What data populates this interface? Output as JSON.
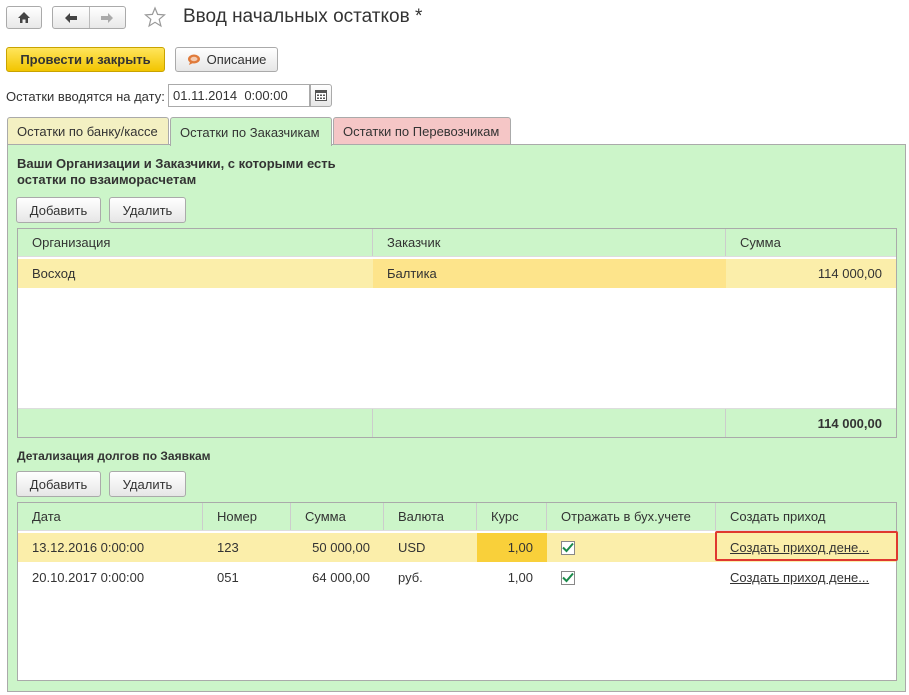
{
  "window": {
    "title": "Ввод начальных остатков *"
  },
  "toolbar": {
    "post_close_label": "Провести и закрыть",
    "description_label": "Описание"
  },
  "date_field": {
    "label": "Остатки вводятся на дату:",
    "value": "01.11.2014  0:00:00"
  },
  "tabs": [
    {
      "label": "Остатки по банку/кассе",
      "color": "#f3f0c2"
    },
    {
      "label": "Остатки по Заказчикам",
      "color": "#ccf5c9",
      "active": true
    },
    {
      "label": "Остатки по Перевозчикам",
      "color": "#f5c6c6"
    }
  ],
  "orgs_section": {
    "title_line1": "Ваши Организации и Заказчики, с которыми есть",
    "title_line2": "остатки по взаиморасчетам",
    "add_label": "Добавить",
    "delete_label": "Удалить",
    "columns": [
      "Организация",
      "Заказчик",
      "Сумма"
    ],
    "rows": [
      {
        "org": "Восход",
        "customer": "Балтика",
        "sum": "114 000,00"
      }
    ],
    "total": "114 000,00"
  },
  "details_section": {
    "title": "Детализация долгов по Заявкам",
    "add_label": "Добавить",
    "delete_label": "Удалить",
    "columns": [
      "Дата",
      "Номер",
      "Сумма",
      "Валюта",
      "Курс",
      "Отражать в бух.учете",
      "Создать приход"
    ],
    "rows": [
      {
        "date": "13.12.2016 0:00:00",
        "number": "123",
        "sum": "50 000,00",
        "currency": "USD",
        "rate": "1,00",
        "reflect": true,
        "create": "Создать приход дене..."
      },
      {
        "date": "20.10.2017 0:00:00",
        "number": "051",
        "sum": "64 000,00",
        "currency": "руб.",
        "rate": "1,00",
        "reflect": true,
        "create": "Создать приход дене..."
      }
    ]
  },
  "colors": {
    "panel_bg": "#ccf5c9",
    "selected_row": "#fbeeaa",
    "selected_cell": "#fde48b",
    "rate_cell": "#f9d03a",
    "primary_button": "#f2c500",
    "highlight_border": "#e0382f"
  }
}
